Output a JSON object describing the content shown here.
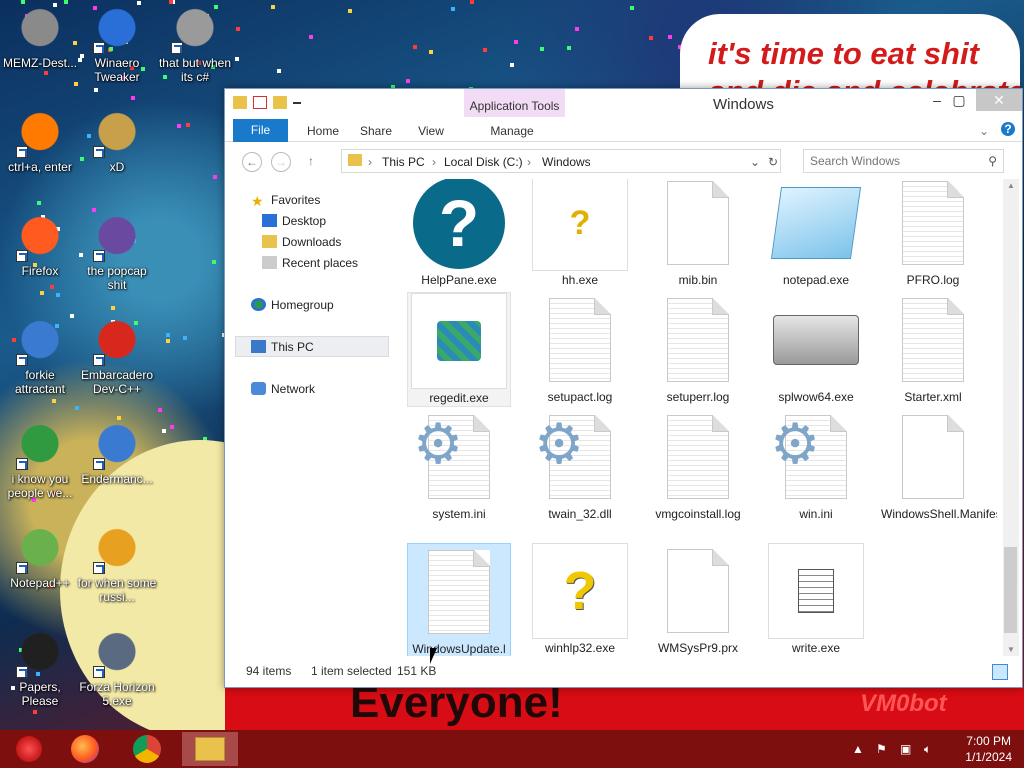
{
  "desktop": {
    "icons": [
      {
        "name": "memz-destructive-icon",
        "label": "MEMZ-Dest...",
        "color": "#8a8a8a"
      },
      {
        "name": "winaero-tweaker-icon",
        "label": "Winaero Tweaker",
        "color": "#2a6ed8"
      },
      {
        "name": "that-but-when-its-csharp-icon",
        "label": "that but when its c#",
        "color": "#9a9a9a"
      },
      {
        "name": "ctrl-a-enter-icon",
        "label": "ctrl+a, enter",
        "color": "#ff7a00"
      },
      {
        "name": "xd-icon",
        "label": "xD",
        "color": "#c8a04a"
      },
      {
        "name": "firefox-icon",
        "label": "Firefox",
        "color": "#ff5a1f"
      },
      {
        "name": "the-popcap-shit-icon",
        "label": "the popcap shit",
        "color": "#6a4aa0"
      },
      {
        "name": "forkie-attractant-icon",
        "label": "forkie attractant",
        "color": "#3a7ad0"
      },
      {
        "name": "embarcadero-devcpp-icon",
        "label": "Embarcadero Dev-C++",
        "color": "#d8281e"
      },
      {
        "name": "chrome-icon",
        "label": "i know you people we...",
        "color": "#2f9a3f"
      },
      {
        "name": "endermanch-icon",
        "label": "Endermanc...",
        "color": "#3a7ad0"
      },
      {
        "name": "notepadpp-icon",
        "label": "Notepad++",
        "color": "#6ab04c"
      },
      {
        "name": "for-when-some-russi-icon",
        "label": "for when some russi...",
        "color": "#e8a020"
      },
      {
        "name": "papers-please-icon",
        "label": "Papers, Please",
        "color": "#202020"
      },
      {
        "name": "forza-horizon-icon",
        "label": "Forza Horizon 5.exe",
        "color": "#5a6a80"
      }
    ],
    "bubble_line1": "it's time to eat shit",
    "bubble_line2": "and die and celebrate",
    "banner_text": "Everyone!",
    "watermark": "VM0bot"
  },
  "window": {
    "title": "Windows",
    "app_tools": "Application Tools",
    "tabs": {
      "file": "File",
      "home": "Home",
      "share": "Share",
      "view": "View",
      "manage": "Manage"
    },
    "breadcrumb": [
      "This PC",
      "Local Disk (C:)",
      "Windows"
    ],
    "search_placeholder": "Search Windows",
    "nav": {
      "favorites": "Favorites",
      "desktop": "Desktop",
      "downloads": "Downloads",
      "recent": "Recent places",
      "homegroup": "Homegroup",
      "thispc": "This PC",
      "network": "Network"
    },
    "files": [
      {
        "label": "HelpPane.exe",
        "icon": "help-icon"
      },
      {
        "label": "hh.exe",
        "icon": "help-file-icon"
      },
      {
        "label": "mib.bin",
        "icon": "blank-file-icon"
      },
      {
        "label": "notepad.exe",
        "icon": "notepad-icon"
      },
      {
        "label": "PFRO.log",
        "icon": "text-file-icon"
      },
      {
        "label": "regedit.exe",
        "icon": "regedit-icon"
      },
      {
        "label": "setupact.log",
        "icon": "text-file-icon"
      },
      {
        "label": "setuperr.log",
        "icon": "text-file-icon"
      },
      {
        "label": "splwow64.exe",
        "icon": "printer-icon"
      },
      {
        "label": "Starter.xml",
        "icon": "text-file-icon"
      },
      {
        "label": "system.ini",
        "icon": "gear-file-icon"
      },
      {
        "label": "twain_32.dll",
        "icon": "gear-file-icon"
      },
      {
        "label": "vmgcoinstall.log",
        "icon": "text-file-icon"
      },
      {
        "label": "win.ini",
        "icon": "gear-file-icon"
      },
      {
        "label": "WindowsShell.Manifest",
        "icon": "blank-file-icon"
      },
      {
        "label": "WindowsUpdate.l",
        "icon": "text-file-icon"
      },
      {
        "label": "winhlp32.exe",
        "icon": "help-question-icon"
      },
      {
        "label": "WMSysPr9.prx",
        "icon": "blank-file-icon"
      },
      {
        "label": "write.exe",
        "icon": "write-icon"
      }
    ],
    "status": {
      "count": "94 items",
      "selected": "1 item selected",
      "size": "151 KB"
    }
  },
  "taskbar": {
    "time": "7:00 PM",
    "date": "1/1/2024"
  }
}
